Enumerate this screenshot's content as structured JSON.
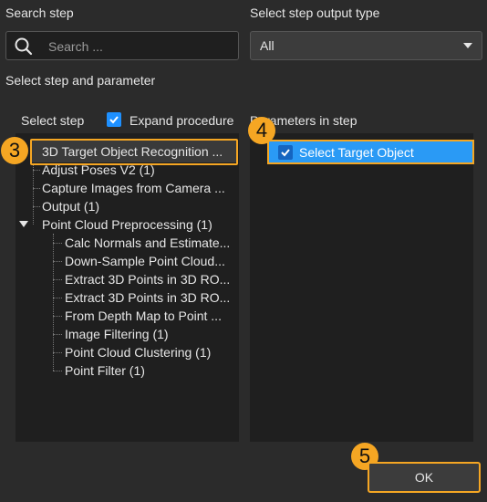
{
  "search": {
    "label": "Search step",
    "placeholder": "Search ..."
  },
  "output_type": {
    "label": "Select step output type",
    "selected": "All"
  },
  "section_label": "Select step and parameter",
  "select_step": {
    "label": "Select step",
    "expand_label": "Expand procedure",
    "expand_checked": true
  },
  "parameters": {
    "label": "Parameters in step",
    "items": [
      {
        "label": "Select Target Object",
        "checked": true
      }
    ]
  },
  "steps": [
    "3D Target Object Recognition ...",
    "Adjust Poses V2 (1)",
    "Capture Images from Camera ...",
    "Output (1)",
    "Point Cloud Preprocessing (1)",
    "Calc Normals and Estimate...",
    "Down-Sample Point Cloud...",
    "Extract 3D Points in 3D RO...",
    "Extract 3D Points in 3D RO...",
    "From Depth Map to Point ...",
    "Image Filtering (1)",
    "Point Cloud Clustering (1)",
    "Point Filter (1)"
  ],
  "badges": [
    "3",
    "4",
    "5"
  ],
  "ok_label": "OK",
  "colors": {
    "accent": "#1e90ff",
    "highlight": "#f5a623",
    "background": "#2b2b2b",
    "panel": "#1f1f1f"
  }
}
